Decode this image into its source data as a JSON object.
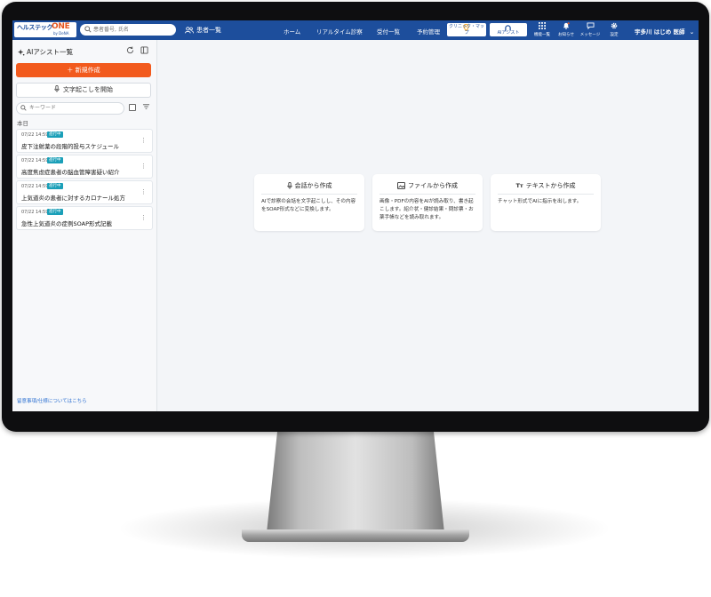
{
  "topbar": {
    "logo_text": "ヘルステック",
    "logo_one": "ONE",
    "logo_sub": "by DeNA",
    "search_placeholder": "患者番号, 氏名",
    "patients_label": "患者一覧",
    "nav": [
      "ホーム",
      "リアルタイム診察",
      "受付一覧",
      "予約管理"
    ],
    "clinic_map_label": "クリニック・マップ",
    "ai_assist_label": "AIアシスト",
    "icons": [
      {
        "icon": "grid-icon",
        "label": "機能一覧"
      },
      {
        "icon": "bell-icon",
        "label": "お知らせ"
      },
      {
        "icon": "message-icon",
        "label": "メッセージ"
      },
      {
        "icon": "gear-icon",
        "label": "設定"
      }
    ],
    "user_name": "宇多川 はじめ 医師"
  },
  "sidebar": {
    "title": "AIアシスト一覧",
    "new_button": "＋ 新規作成",
    "transcribe_button": "文字起こしを開始",
    "keyword_placeholder": "キーワード",
    "section_label": "本日",
    "items": [
      {
        "datetime": "07/22 14:59",
        "status": "進行中",
        "title": "皮下注射薬の段階的投与スケジュール"
      },
      {
        "datetime": "07/22 14:59",
        "status": "進行中",
        "title": "高度焦虑症患者の脳血管障害疑い紹介"
      },
      {
        "datetime": "07/22 14:59",
        "status": "進行中",
        "title": "上気道炎の患者に対するカロナール処方"
      },
      {
        "datetime": "07/22 14:59",
        "status": "進行中",
        "title": "急性上気道炎の症例SOAP形式記載"
      }
    ],
    "footer_link": "留意事項/仕様についてはこちら"
  },
  "main": {
    "cards": [
      {
        "title": "会話から作成",
        "icon": "microphone-icon",
        "description": "AIで診察の会話を文字起こしし、その内容をSOAP形式などに変換します。"
      },
      {
        "title": "ファイルから作成",
        "icon": "image-icon",
        "description": "画像・PDFの内容をAIが読み取り、書き起こします。紹介状・健診結果・問診票・お薬手帳などを読み取れます。"
      },
      {
        "title": "テキストから作成",
        "icon": "text-icon",
        "description": "チャット形式でAIに指示を出します。"
      }
    ]
  },
  "colors": {
    "header": "#1d4e9c",
    "primary_button": "#f25a1d",
    "badge": "#1a9fb8",
    "link": "#2b6fd1"
  }
}
